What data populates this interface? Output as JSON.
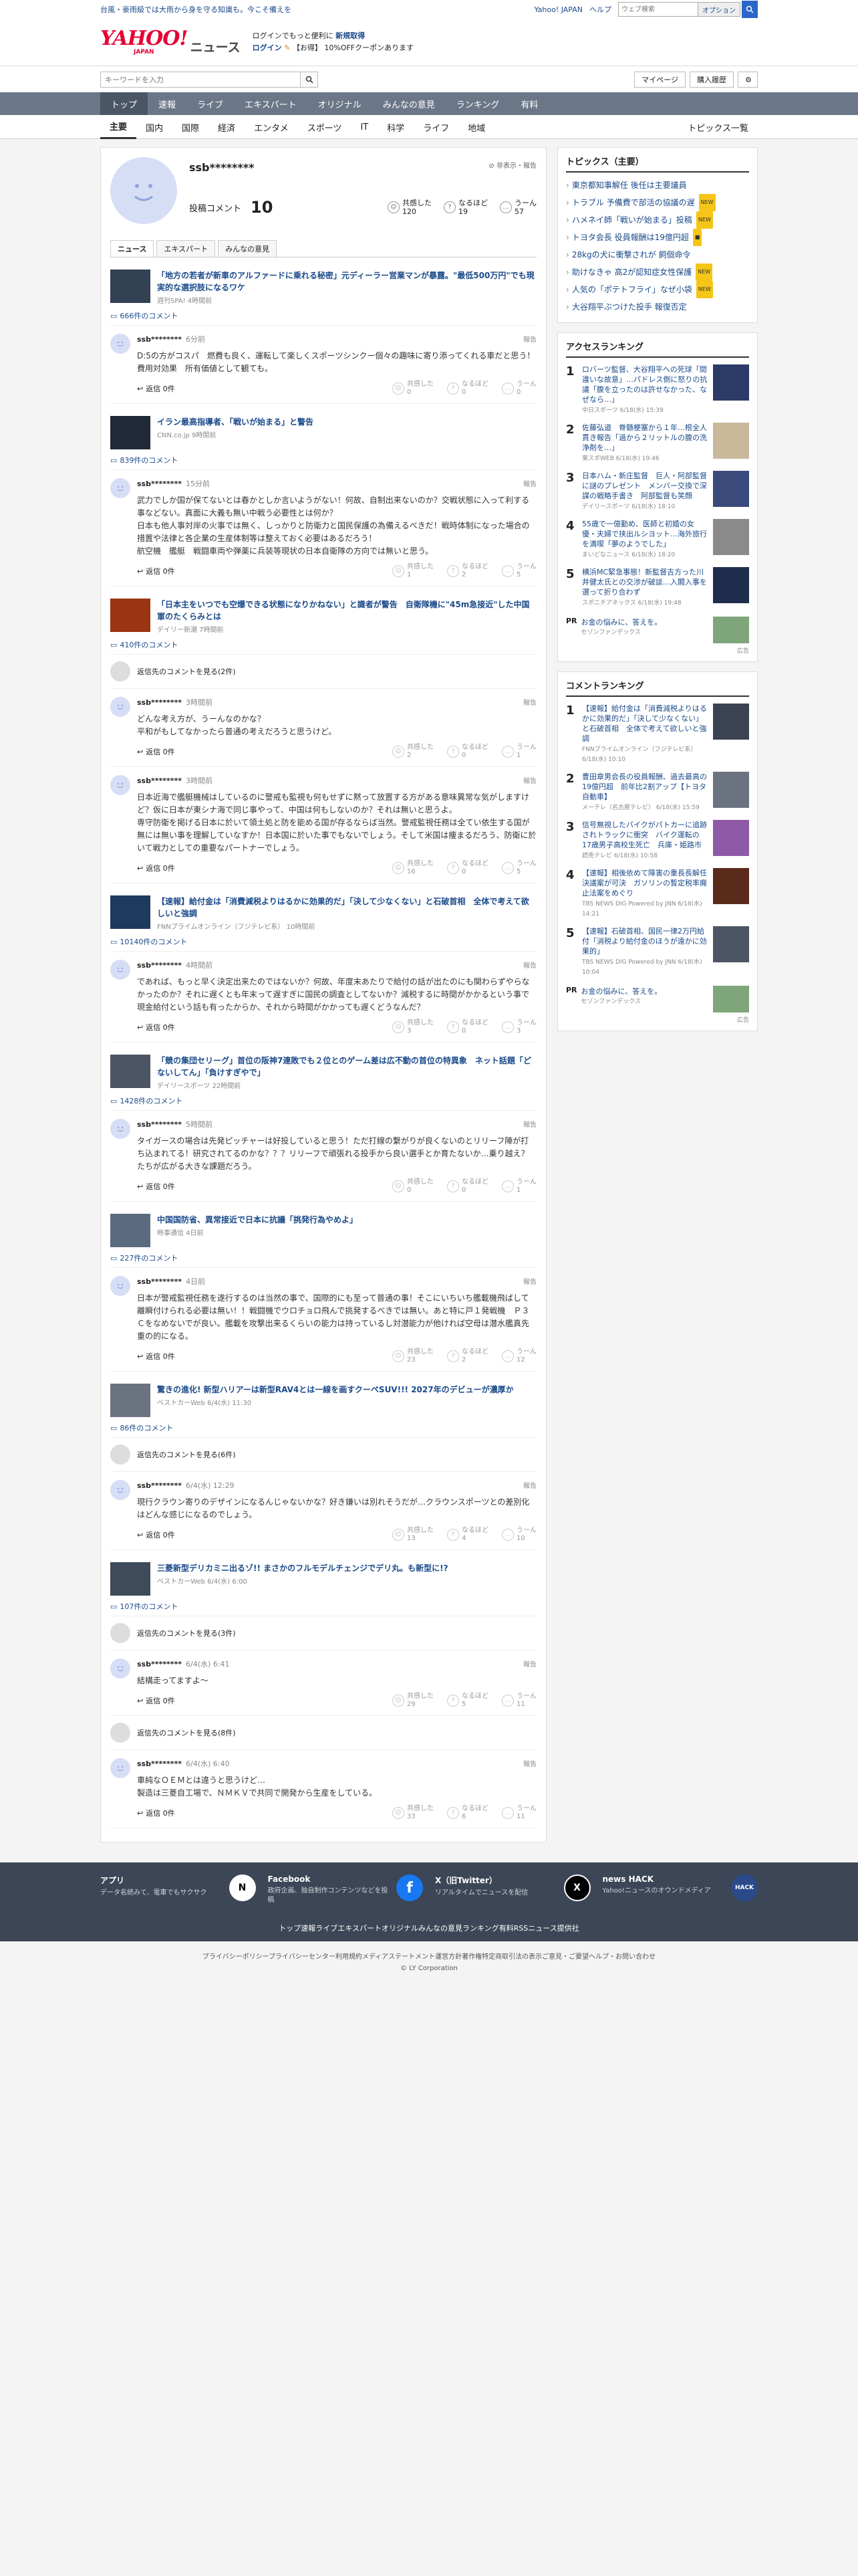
{
  "topbar": {
    "promo": "台風・豪雨級では大雨から身を守る知識も。今こそ備えを",
    "links": [
      "Yahoo! JAPAN",
      "ヘルプ"
    ],
    "search_placeholder": "ウェブ検索",
    "search_toggle": "オプション"
  },
  "header": {
    "logo_main": "YAHOO!",
    "logo_sub": "JAPAN",
    "logo_news": "ニュース",
    "info_line1_a": "ログインでもっと便利に",
    "info_line1_b": "新規取得",
    "info_line2_a": "ログイン",
    "info_line2_b": "【お得】 10%OFFクーポンあります"
  },
  "searchrow": {
    "placeholder": "キーワードを入力",
    "mypage": "マイページ",
    "purchase": "購入履歴"
  },
  "nav1": [
    "トップ",
    "速報",
    "ライブ",
    "エキスパート",
    "オリジナル",
    "みんなの意見",
    "ランキング",
    "有料"
  ],
  "nav2": [
    "主要",
    "国内",
    "国際",
    "経済",
    "エンタメ",
    "スポーツ",
    "IT",
    "科学",
    "ライフ",
    "地域"
  ],
  "nav2_right": "トピックス一覧",
  "profile": {
    "name": "ssb********",
    "flags": "非表示・報告",
    "posts_label": "投稿コメント",
    "posts_count": "10",
    "reacts": [
      {
        "label": "共感した",
        "count": "120"
      },
      {
        "label": "なるほど",
        "count": "19"
      },
      {
        "label": "うーん",
        "count": "57"
      }
    ],
    "tabs": [
      "ニュース",
      "エキスパート",
      "みんなの意見"
    ]
  },
  "labels": {
    "reply": "返信 0件",
    "report": "報告",
    "vote_agree": "共感した",
    "vote_hmm": "なるほど",
    "vote_um": "うーん"
  },
  "articles": [
    {
      "title": "「地方の若者が新車のアルファードに乗れる秘密」元ディーラー営業マンが暴露。\"最低500万円\"でも現実的な選択肢になるワケ",
      "source": "週刊SPA! 4時間前",
      "count": "666件のコメント",
      "more": "",
      "comment": {
        "name": "ssb********",
        "time": "6分前",
        "text": "D:5の方がコスパ　燃費も良く、運転して楽しくスポーツシンクー個々の趣味に寄り添ってくれる車だと思う！費用対効果　所有価値として観ても。",
        "votes": [
          "0",
          "0",
          "0"
        ]
      }
    },
    {
      "title": "イラン最高指導者、「戦いが始まる」と警告",
      "source": "CNN.co.jp 9時間前",
      "count": "839件のコメント",
      "more": "",
      "comment": {
        "name": "ssb********",
        "time": "15分前",
        "text": "武力でしか国が保てないとは春かとしか言いようがない！何故、自制出来ないのか？交戦状態に入って利する事などない。真面に大義も無い中戦う必要性とは何か？\n日本も他人事対岸の火事では無く、しっかりと防衛力と国民保護の為備えるべきだ！戦時体制になった場合の措置や法律と各企業の生産体制等は整えておく必要はあるだろう！\n航空機　艦艇　戦闘車両や弾薬に兵装等現状の日本自衛隊の方向では無いと思う。",
        "votes": [
          "1",
          "2",
          "5"
        ]
      }
    },
    {
      "title": "「日本主をいつでも空爆できる状態になりかねない」と識者が警告　自衛隊機に\"45m急接近\"した中国軍のたくらみとは",
      "source": "デイリー新潮 7時間前",
      "count": "410件のコメント",
      "more": "返信先のコメントを見る(2件)",
      "comment": {
        "name": "ssb********",
        "time": "3時間前",
        "text": "どんな考え方が、うーんなのかな？\n平和がもしてなかったら普通の考えだろうと思うけど。",
        "votes": [
          "2",
          "0",
          "1"
        ]
      }
    },
    {
      "title": "",
      "source": "",
      "count": "",
      "more": "",
      "comment": {
        "name": "ssb********",
        "time": "3時間前",
        "text": "日本近海で艦艇機械はしているのに警戒も監視も何もせずに黙って放置する方がある意味異常な気がしますけど？仮に日本が東シナ海で同じ事やって、中国は何もしないのか？それは無いと思うよ。\n専守防衛を掲げる日本に於いて領土処と防を能める国が存るならば当然。警戒監視任務は全てい依生する国が無には無い事を理解していなすか！日本国に於いた事でもないでしょう。そして米国は痩まるだろう、防衛に於いて戦力としての重要なパートナーでしょう。",
        "votes": [
          "16",
          "0",
          "5"
        ]
      }
    },
    {
      "title": "【速報】給付金は「消費減税よりはるかに効果的だ」「決して少なくない」と石破首相　全体で考えて欲しいと強調",
      "source": "FNNプライムオンライン（フジテレビ系） 10時間前",
      "count": "10140件のコメント",
      "more": "",
      "comment": {
        "name": "ssb********",
        "time": "4時間前",
        "text": "であれば、もっと早く決定出来たのではないか？何故、年度末あたりで給付の話が出たのにも関わらずやらなかったのか？それに遅くとも年末って遅すぎに国民の調査としてないか？減税するに時間がかかるという事で現金給付という話も有ったからか、それから時間がかかっても遅くどうなんだ？",
        "votes": [
          "3",
          "0",
          "3"
        ]
      }
    },
    {
      "title": "「競の集団セリーグ」首位の阪神7連敗でも２位とのゲーム差は広不動の首位の特異象　ネット話題「どないしてん」「負けすぎやで」",
      "source": "デイリースポーツ 22時間前",
      "count": "1428件のコメント",
      "more": "",
      "comment": {
        "name": "ssb********",
        "time": "5時間前",
        "text": "タイガースの場合は先発ピッチャーは好投していると思う！ただ打線の繋がりが良くないのとリリーフ陣が打ち込まれてる！研究されてるのかな？？？リリーフで頑張れる投手から良い選手とか育たないか…乗り越え？たちが広がる大きな課題だろう。",
        "votes": [
          "0",
          "0",
          "1"
        ]
      }
    },
    {
      "title": "中国国防省、異常接近で日本に抗議「挑発行為やめよ」",
      "source": "時事通信 4日前",
      "count": "227件のコメント",
      "more": "",
      "comment": {
        "name": "ssb********",
        "time": "4日前",
        "text": "日本が警戒監視任務を遂行するのは当然の事で、国際的にも至って普通の事！そこにいちいち艦載機飛ばして離瞬付けられる必要は無い！！戦闘機でウロチョロ飛んで挑発するべきでは無い。あと特に戸１発戦機　Ｐ３Ｃをなめないでが良い。艦載を攻撃出来るくらいの能力は持っているし対潜能力が他ければ空母は潜水艦真先重の的になる。",
        "votes": [
          "23",
          "2",
          "12"
        ]
      }
    },
    {
      "title": "驚きの進化! 新型ハリアーは新型RAV4とは一線を画すクーペSUV!!! 2027年のデビューが濃厚か",
      "source": "ベストカーWeb 6/4(水) 11:30",
      "count": "86件のコメント",
      "more": "返信先のコメントを見る(6件)",
      "comment": {
        "name": "ssb********",
        "time": "6/4(水) 12:29",
        "text": "現行クラウン寄りのデザインになるんじゃないかな？好き嫌いは別れそうだが…クラウンスポーツとの差別化はどんな感じになるのでしょう。",
        "votes": [
          "13",
          "4",
          "10"
        ]
      }
    },
    {
      "title": "三菱新型デリカミニ出るゾ!! まさかのフルモデルチェンジでデリ丸。も新型に!?",
      "source": "ベストカーWeb 6/4(水) 6:00",
      "count": "107件のコメント",
      "more": "返信先のコメントを見る(3件)",
      "comment": {
        "name": "ssb********",
        "time": "6/4(水) 6:41",
        "text": "結構走ってますよ〜",
        "votes": [
          "29",
          "5",
          "11"
        ]
      }
    },
    {
      "title": "",
      "source": "",
      "count": "",
      "more": "返信先のコメントを見る(8件)",
      "comment": {
        "name": "ssb********",
        "time": "6/4(水) 6:40",
        "text": "車純なＯＥＭとは違うと思うけど…\n製造は三菱自工場で、ＮＭＫＶで共同で開発から生産をしている。",
        "votes": [
          "33",
          "6",
          "11"
        ]
      }
    }
  ],
  "side": {
    "topics_heading": "トピックス（主要）",
    "topics": [
      {
        "text": "東京都知事解任 後任は主要議員",
        "badge": ""
      },
      {
        "text": "トラブル 予備費で部活の協議の遅",
        "badge": "NEW"
      },
      {
        "text": "ハメネイ師「戦いが始まる」投稿",
        "badge": "NEW"
      },
      {
        "text": "トヨタ会長 役員報酬は19億円超",
        "badge": "■"
      },
      {
        "text": "28kgの犬に衝撃されが 飼個命令",
        "badge": ""
      },
      {
        "text": "助けなきゃ 高2が認知症女性保護",
        "badge": "NEW"
      },
      {
        "text": "人気の「ポテトフライ」なぜ小袋",
        "badge": "NEW"
      },
      {
        "text": "大谷翔平ぶつけた投手 報復否定",
        "badge": ""
      }
    ],
    "access_heading": "アクセスランキング",
    "access": [
      {
        "no": "1",
        "title": "ロバーツ監督、大谷翔平への死球「間違いな故意」…パドレス側に怒りの抗議「腹を立ったのは許せなかった、なぜなら…」",
        "src": "中日スポーツ 6/18(水) 15:39"
      },
      {
        "no": "2",
        "title": "佐藤弘道　脊髄梗塞から１年…根全人貫き報告「過から２リットルの腹の洗浄剤を…」",
        "src": "東スポWEB 6/18(水) 19:46"
      },
      {
        "no": "3",
        "title": "日本ハム・新庄監督　巨人・阿部監督に謎のプレゼント　メンバー交換で深謀の戦略手書き　阿部監督も笑顔",
        "src": "デイリースポーツ 6/18(水) 18:10"
      },
      {
        "no": "4",
        "title": "55歳で一億勤め、医師と初婚の女優・夫婦で挟出ルシヨット…海外旅行を満喫「夢のようでした」",
        "src": "まいどなニュース 6/18(水) 18:20"
      },
      {
        "no": "5",
        "title": "横浜MC緊急事態！新監督吉方った川井健太氏との交渉が破談…入閣入事を選って折り合わず",
        "src": "スポニチアネックス 6/18(水) 19:48"
      }
    ],
    "pr_label": "PR",
    "pr_title": "お金の悩みに、答えを。",
    "pr_src": "セゾンファンデックス",
    "pr_ad": "広告",
    "comment_heading": "コメントランキング",
    "comment_rank": [
      {
        "no": "1",
        "title": "【速報】給付金は「消費減税よりはるかに効果的だ」「決して少なくない」と石破首相　全体で考えて欲しいと強調",
        "src": "FNNプライムオンライン（フジテレビ系） 6/18(水) 10:10"
      },
      {
        "no": "2",
        "title": "豊田章男会長の役員報酬、過去最高の19億円超　前年比2割アップ【トヨタ自動車】",
        "src": "メーテレ（名古屋テレビ） 6/18(水) 15:59"
      },
      {
        "no": "3",
        "title": "信号無視したバイクがパトカーに追跡されトラックに衝突　バイク運転の17歳男子高校生死亡　兵庫・姫路市",
        "src": "読売テレビ 6/18(水) 10:58"
      },
      {
        "no": "4",
        "title": "【速報】相後依めて障害の重長長解任決議案が可決　ガソリンの暫定税率廃止法案をめぐり",
        "src": "TBS NEWS DIG Powered by JNN 6/18(水) 14:21"
      },
      {
        "no": "5",
        "title": "【速報】石破首相、国民一律2万円給付「消税より給付金のほうが遠かに効果的」",
        "src": "TBS NEWS DIG Powered by JNN 6/18(水) 10:04"
      }
    ]
  },
  "footer": {
    "apps": [
      {
        "title": "アプリ",
        "desc": "データ名続みて、電車でもサクサク",
        "icon": "N"
      },
      {
        "title": "Facebook",
        "desc": "政府企画、独自制作コンテンツなどを投稿",
        "icon": "f"
      },
      {
        "title": "X（旧Twitter）",
        "desc": "リアルタイムでニュースを配信",
        "icon": "X"
      },
      {
        "title": "news HACK",
        "desc": "Yahoo!ニュースのオウンドメディア",
        "icon": "HACK"
      }
    ],
    "links": [
      "トップ",
      "速報",
      "ライブ",
      "エキスパート",
      "オリジナル",
      "みんなの意見",
      "ランキング",
      "有料",
      "RSS",
      "ニュース提供社"
    ],
    "legal": [
      "プライバシーポリシー",
      "プライバシーセンター",
      "利用規約",
      "メディアステートメント",
      "運営方針",
      "著作権",
      "特定商取引法の表示",
      "ご意見・ご要望",
      "ヘルプ・お問い合わせ"
    ],
    "copyright": "© LY Corporation"
  },
  "colors": {
    "accent": "#1a4a8a",
    "brand": "#e60033",
    "nav": "#6b7788"
  }
}
